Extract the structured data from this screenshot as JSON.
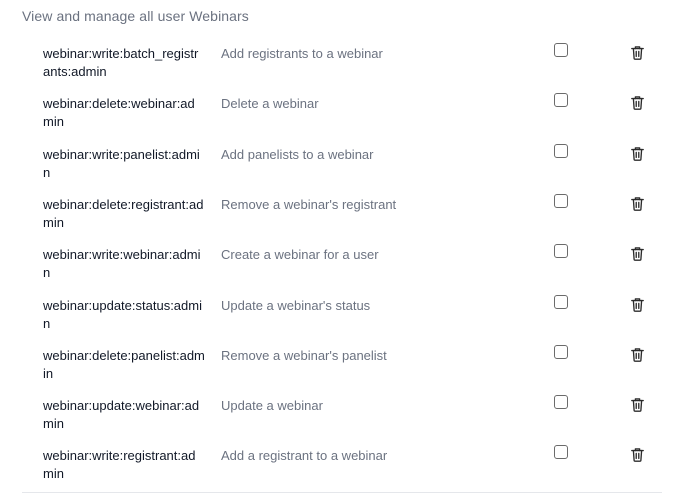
{
  "section": {
    "title": "View and manage all user Webinars"
  },
  "scopes": [
    {
      "name": "webinar:write:batch_registrants:admin",
      "description": "Add registrants to a webinar",
      "checked": false
    },
    {
      "name": "webinar:delete:webinar:admin",
      "description": "Delete a webinar",
      "checked": false
    },
    {
      "name": "webinar:write:panelist:admin",
      "description": "Add panelists to a webinar",
      "checked": false
    },
    {
      "name": "webinar:delete:registrant:admin",
      "description": "Remove a webinar's registrant",
      "checked": false
    },
    {
      "name": "webinar:write:webinar:admin",
      "description": "Create a webinar for a user",
      "checked": false
    },
    {
      "name": "webinar:update:status:admin",
      "description": "Update a webinar's status",
      "checked": false
    },
    {
      "name": "webinar:delete:panelist:admin",
      "description": "Remove a webinar's panelist",
      "checked": false
    },
    {
      "name": "webinar:update:webinar:admin",
      "description": "Update a webinar",
      "checked": false
    },
    {
      "name": "webinar:write:registrant:admin",
      "description": "Add a registrant to a webinar",
      "checked": false
    }
  ],
  "icons": {
    "delete": "trash-icon"
  }
}
